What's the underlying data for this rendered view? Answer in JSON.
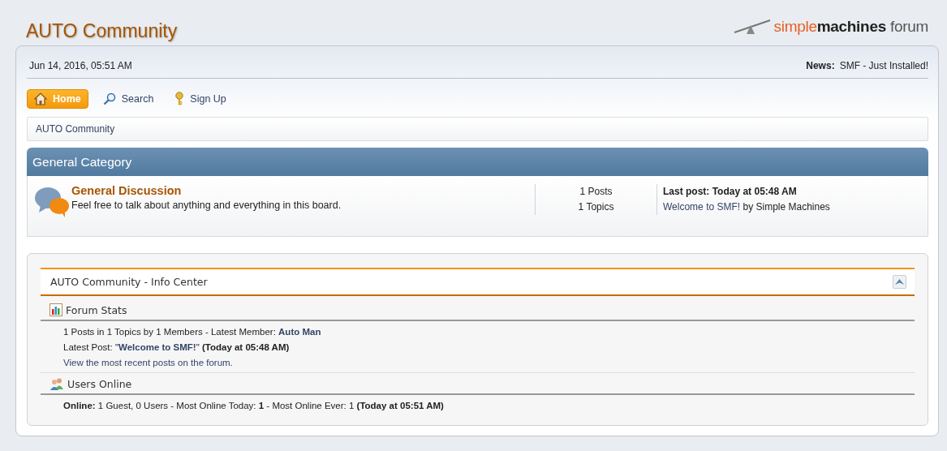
{
  "site_title": "AUTO Community",
  "logo": {
    "parts": [
      "simple",
      "machines",
      " forum"
    ]
  },
  "date": "Jun 14, 2016, 05:51 AM",
  "news": {
    "label": "News:",
    "text": "SMF - Just Installed!"
  },
  "menu": [
    {
      "label": "Home",
      "kind": "home",
      "selected": true
    },
    {
      "label": "Search",
      "kind": "search",
      "selected": false
    },
    {
      "label": "Sign Up",
      "kind": "signup",
      "selected": false
    }
  ],
  "breadcrumb": [
    "AUTO Community"
  ],
  "category": {
    "title": "General Category",
    "boards": [
      {
        "name": "General Discussion",
        "description": "Feel free to talk about anything and everything in this board.",
        "posts": "1 Posts",
        "topics": "1 Topics",
        "last_post": "Last post: Today at 05:48 AM",
        "last_topic": "Welcome to SMF!",
        "last_by": " by Simple Machines"
      }
    ]
  },
  "info_center": {
    "title": "AUTO Community - Info Center",
    "sections": [
      {
        "title": "Forum Stats",
        "kind": "stats",
        "lines": [
          [
            {
              "kind": "text",
              "text": "1 Posts in 1 Topics by 1 Members - Latest Member: "
            },
            {
              "kind": "strong_link",
              "text": "Auto Man"
            }
          ],
          [
            {
              "kind": "text",
              "text": "Latest Post: \""
            },
            {
              "kind": "strong_link",
              "text": "Welcome to SMF!"
            },
            {
              "kind": "text",
              "text": "\" **(Today at 05:48 AM)**"
            }
          ],
          [
            {
              "kind": "link",
              "text": "View the most recent posts on the forum."
            }
          ]
        ]
      },
      {
        "title": "Users Online",
        "kind": "users",
        "lines": [
          [
            {
              "kind": "text",
              "text": "**Online:** 1 Guest, 0 Users  - Most Online Today: **1** -  Most Online Ever: 1 **(Today at 05:51 AM)**"
            }
          ]
        ]
      }
    ]
  }
}
